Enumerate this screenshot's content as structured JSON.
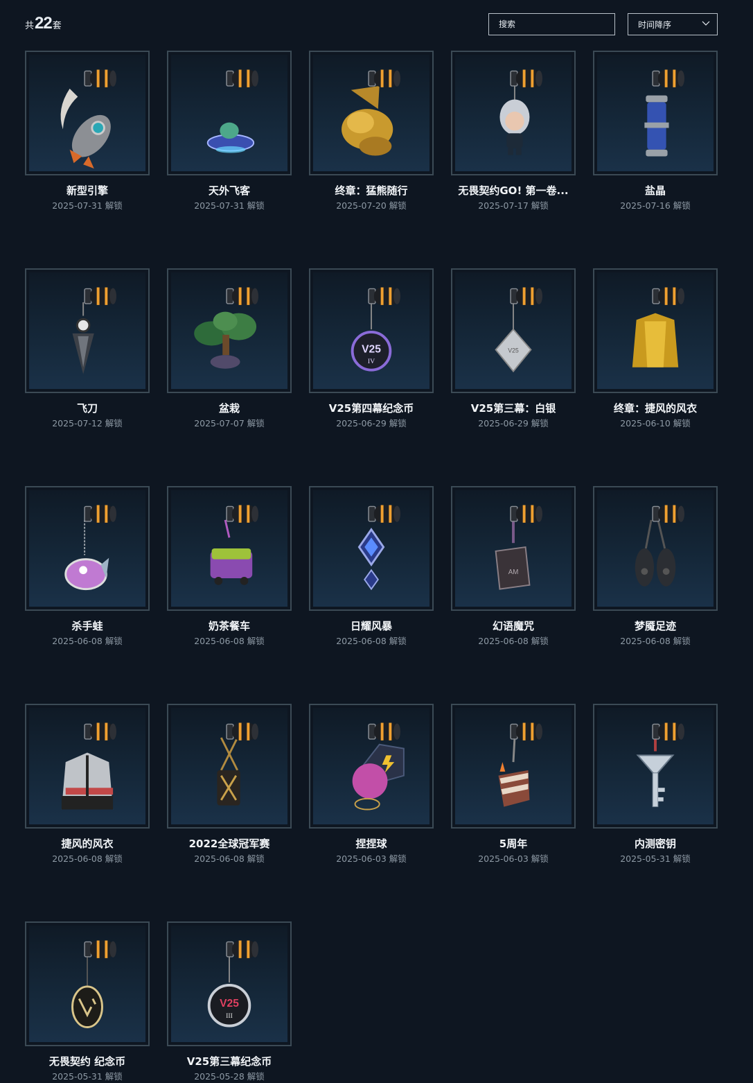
{
  "header": {
    "count_prefix": "共",
    "count_value": "22",
    "count_suffix": "套",
    "search_placeholder": "搜索",
    "sort_label": "时间降序"
  },
  "items": [
    {
      "title": "新型引擎",
      "date": "2025-07-31 解锁",
      "icon": "rocket-charm-icon"
    },
    {
      "title": "天外飞客",
      "date": "2025-07-31 解锁",
      "icon": "ufo-charm-icon"
    },
    {
      "title": "终章：猛熊随行",
      "date": "2025-07-20 解锁",
      "icon": "golden-bear-charm-icon"
    },
    {
      "title": "无畏契约GO! 第一卷...",
      "date": "2025-07-17 解锁",
      "icon": "chibi-agent-charm-icon"
    },
    {
      "title": "盐晶",
      "date": "2025-07-16 解锁",
      "icon": "salt-crystal-charm-icon"
    },
    {
      "title": "飞刀",
      "date": "2025-07-12 解锁",
      "icon": "kunai-charm-icon"
    },
    {
      "title": "盆栽",
      "date": "2025-07-07 解锁",
      "icon": "bonsai-charm-icon"
    },
    {
      "title": "V25第四幕纪念币",
      "date": "2025-06-29 解锁",
      "icon": "v25-act4-coin-icon"
    },
    {
      "title": "V25第三幕：白银",
      "date": "2025-06-29 解锁",
      "icon": "v25-silver-charm-icon"
    },
    {
      "title": "终章：捷风的风衣",
      "date": "2025-06-10 解锁",
      "icon": "golden-jacket-charm-icon"
    },
    {
      "title": "杀手蛙",
      "date": "2025-06-08 解锁",
      "icon": "frog-charm-icon"
    },
    {
      "title": "奶茶餐车",
      "date": "2025-06-08 解锁",
      "icon": "food-truck-charm-icon"
    },
    {
      "title": "日耀风暴",
      "date": "2025-06-08 解锁",
      "icon": "blue-gem-charm-icon"
    },
    {
      "title": "幻语魔咒",
      "date": "2025-06-08 解锁",
      "icon": "spellbook-charm-icon"
    },
    {
      "title": "梦魇足迹",
      "date": "2025-06-08 解锁",
      "icon": "paw-boots-charm-icon"
    },
    {
      "title": "捷风的风衣",
      "date": "2025-06-08 解锁",
      "icon": "jacket-charm-icon"
    },
    {
      "title": "2022全球冠军赛",
      "date": "2025-06-08 解锁",
      "icon": "champions-2022-charm-icon"
    },
    {
      "title": "捏捏球",
      "date": "2025-06-03 解锁",
      "icon": "squeeze-ball-charm-icon"
    },
    {
      "title": "5周年",
      "date": "2025-06-03 解锁",
      "icon": "cake-charm-icon"
    },
    {
      "title": "内测密钥",
      "date": "2025-05-31 解锁",
      "icon": "beta-key-charm-icon"
    },
    {
      "title": "无畏契约 纪念币",
      "date": "2025-05-31 解锁",
      "icon": "valorant-coin-icon"
    },
    {
      "title": "V25第三幕纪念币",
      "date": "2025-05-28 解锁",
      "icon": "v25-act3-coin-icon"
    }
  ],
  "colors": {
    "background": "#0e1621",
    "card_border": "#3b4a55",
    "title_text": "#f2f5f8",
    "date_text": "#8e9aa5",
    "clip_accent": "#f0a030"
  }
}
